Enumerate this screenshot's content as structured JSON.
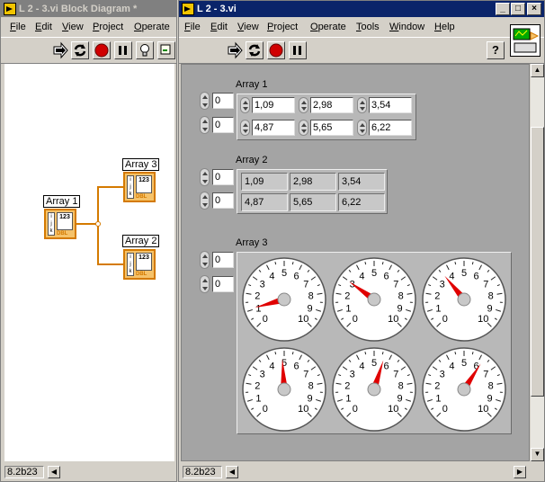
{
  "diagram_window": {
    "title": "L 2 - 3.vi Block Diagram *",
    "menu": [
      {
        "label": "File",
        "u": "F",
        "rest": "ile"
      },
      {
        "label": "Edit",
        "u": "E",
        "rest": "dit"
      },
      {
        "label": "View",
        "u": "V",
        "rest": "iew"
      },
      {
        "label": "Project",
        "u": "P",
        "rest": "roject"
      },
      {
        "label": "Operate",
        "u": "O",
        "rest": "perate"
      }
    ],
    "status": "8.2b23",
    "nodes": {
      "array1": {
        "label": "Array 1",
        "inner": "123",
        "type": "DBL"
      },
      "array3": {
        "label": "Array 3",
        "inner": "123",
        "type": "DBL"
      },
      "array2": {
        "label": "Array 2",
        "inner": "123",
        "type": "DBL"
      }
    }
  },
  "panel_window": {
    "title": "L 2 - 3.vi",
    "menu": [
      {
        "label": "File",
        "u": "F",
        "rest": "ile"
      },
      {
        "label": "Edit",
        "u": "E",
        "rest": "dit"
      },
      {
        "label": "View",
        "u": "V",
        "rest": "iew"
      },
      {
        "label": "Project",
        "u": "P",
        "rest": "roject"
      },
      {
        "label": "Operate",
        "u": "O",
        "rest": "perate"
      },
      {
        "label": "Tools",
        "u": "T",
        "rest": "ools"
      },
      {
        "label": "Window",
        "u": "W",
        "rest": "indow"
      },
      {
        "label": "Help",
        "u": "H",
        "rest": "elp"
      }
    ],
    "status": "8.2b23",
    "help_icon": "?"
  },
  "front_panel": {
    "array1": {
      "label": "Array 1",
      "row_index": "0",
      "col_index": "0",
      "values": [
        [
          "1,09",
          "2,98",
          "3,54"
        ],
        [
          "4,87",
          "5,65",
          "6,22"
        ]
      ]
    },
    "array2": {
      "label": "Array 2",
      "row_index": "0",
      "col_index": "0",
      "values": [
        [
          "1,09",
          "2,98",
          "3,54"
        ],
        [
          "4,87",
          "5,65",
          "6,22"
        ]
      ]
    },
    "array3": {
      "label": "Array 3",
      "row_index": "0",
      "col_index": "0",
      "gauge_scale": [
        "0",
        "1",
        "2",
        "3",
        "4",
        "5",
        "6",
        "7",
        "8",
        "9",
        "10"
      ],
      "gauge_values": [
        [
          1.09,
          2.98,
          3.54
        ],
        [
          4.87,
          5.65,
          6.22
        ]
      ],
      "needle_color": "#e00000"
    }
  }
}
